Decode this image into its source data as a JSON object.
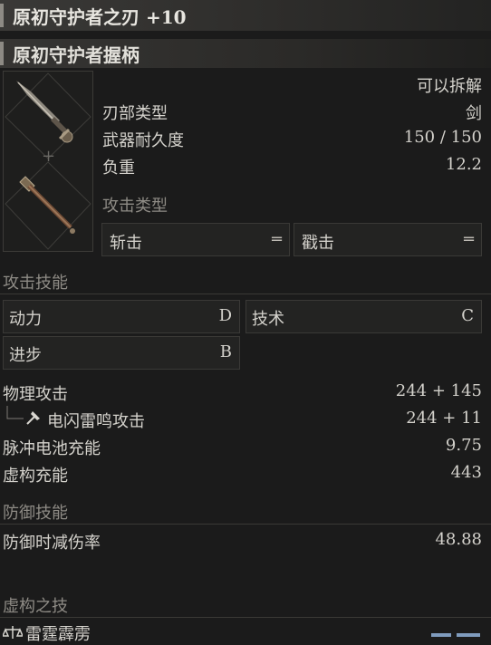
{
  "header": {
    "title": "原初守护者之刃 +10"
  },
  "part": {
    "name": "原初守护者握柄"
  },
  "item": {
    "dismantle": "可以拆解",
    "blade_type_label": "刃部类型",
    "blade_type_value": "剑",
    "durability_label": "武器耐久度",
    "durability_value": "150 / 150",
    "weight_label": "负重",
    "weight_value": "12.2",
    "attack_type_title": "攻击类型",
    "attack_types": [
      {
        "label": "斩击",
        "icon": "equals-icon"
      },
      {
        "label": "戳击",
        "icon": "equals-icon"
      }
    ]
  },
  "attack_skills": {
    "title": "攻击技能",
    "items": [
      {
        "label": "动力",
        "grade": "D"
      },
      {
        "label": "技术",
        "grade": "C"
      },
      {
        "label": "进步",
        "grade": "B"
      }
    ]
  },
  "stats": {
    "physical_label": "物理攻击",
    "physical_value": "244 + 145",
    "lightning_label": "电闪雷鸣攻击",
    "lightning_value": "244 + 11",
    "pulse_label": "脉冲电池充能",
    "pulse_value": "9.75",
    "fable_label": "虚构充能",
    "fable_value": "443"
  },
  "defense": {
    "title": "防御技能",
    "reduction_label": "防御时减伤率",
    "reduction_value": "48.88"
  },
  "fable_arts": {
    "title": "虚构之技",
    "skill_name": "雷霆霹雳"
  }
}
